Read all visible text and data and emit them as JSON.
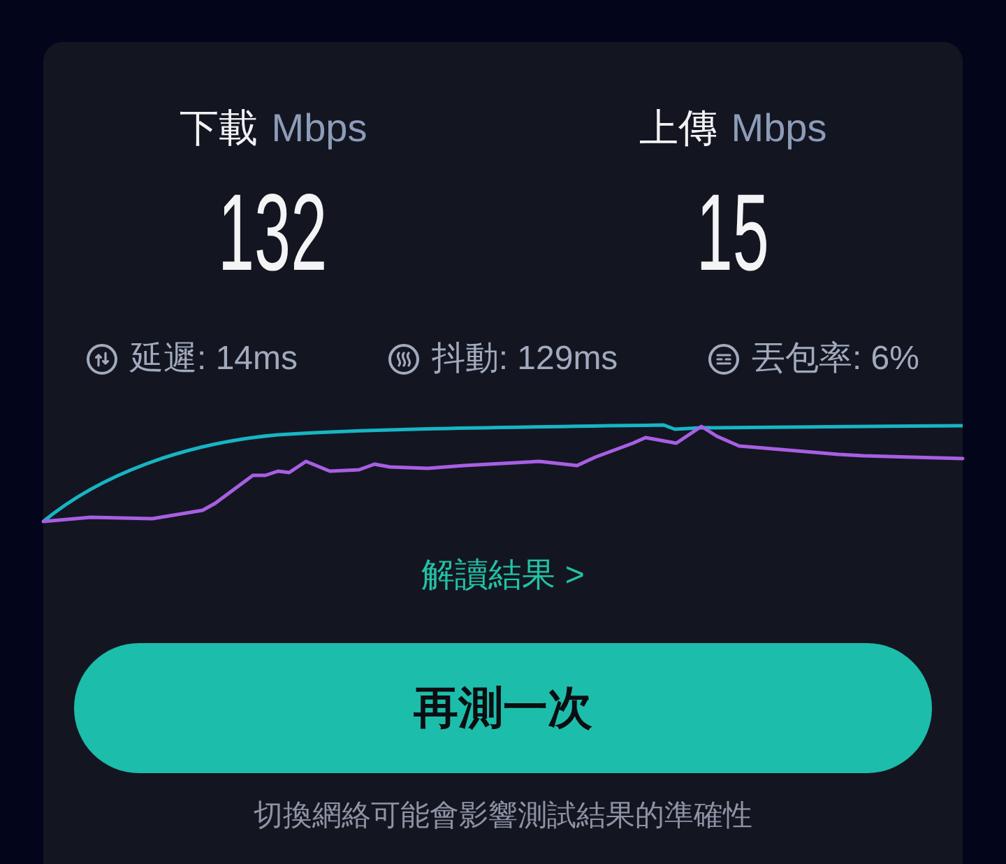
{
  "results": [
    {
      "label": "下載",
      "unit": "Mbps",
      "value": "132"
    },
    {
      "label": "上傳",
      "unit": "Mbps",
      "value": "15"
    }
  ],
  "metrics": [
    {
      "kind": "latency",
      "text": "延遲: 14ms"
    },
    {
      "kind": "jitter",
      "text": "抖動: 129ms"
    },
    {
      "kind": "packet_loss",
      "text": "丟包率: 6%"
    }
  ],
  "details_link": "解讀結果 >",
  "retest_button": "再測一次",
  "note": "切換網絡可能會影響測試結果的準確性"
}
